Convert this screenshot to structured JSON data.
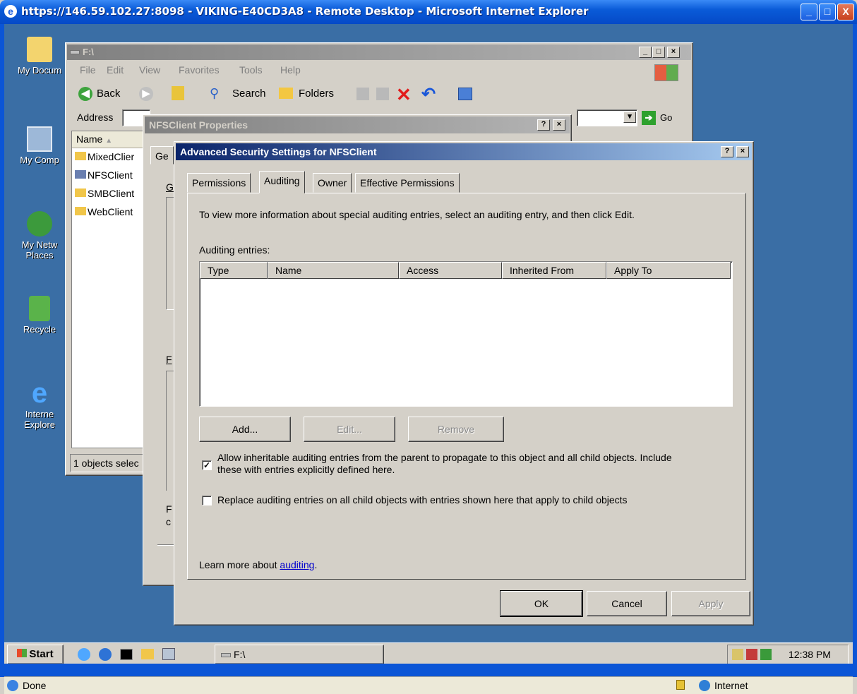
{
  "ie": {
    "title": "https://146.59.102.27:8098 - VIKING-E40CD3A8 - Remote Desktop - Microsoft Internet Explorer",
    "controls": {
      "minimize": "_",
      "maximize": "□",
      "close": "X"
    }
  },
  "desktop": {
    "icons": [
      {
        "label": "My Docum"
      },
      {
        "label": "My Comp"
      },
      {
        "label": "My Netw\nPlaces"
      },
      {
        "label": "Recycle"
      },
      {
        "label": "Interne\nExplore"
      }
    ]
  },
  "explorer": {
    "title": "F:\\",
    "menu": [
      "File",
      "Edit",
      "View",
      "Favorites",
      "Tools",
      "Help"
    ],
    "toolbar": {
      "back": "Back",
      "search": "Search",
      "folders": "Folders"
    },
    "address_label": "Address",
    "go_label": "Go",
    "column_name": "Name",
    "items": [
      "MixedClier",
      "NFSClient",
      "SMBClient",
      "WebClient"
    ],
    "status": "1 objects selec"
  },
  "properties": {
    "title": "NFSClient Properties",
    "tab_first": "Ge",
    "letters": [
      "G",
      "F",
      "F",
      "c"
    ]
  },
  "advanced": {
    "title": "Advanced Security Settings for NFSClient",
    "tabs": [
      "Permissions",
      "Auditing",
      "Owner",
      "Effective Permissions"
    ],
    "active_tab": "Auditing",
    "info_text": "To view more information about special auditing entries, select an auditing entry, and then click Edit.",
    "entries_label": "Auditing entries:",
    "columns": [
      "Type",
      "Name",
      "Access",
      "Inherited From",
      "Apply To"
    ],
    "buttons": {
      "add": "Add...",
      "edit": "Edit...",
      "remove": "Remove"
    },
    "check_inherit_line1": "Allow inheritable auditing entries from the parent to propagate to this object and all child objects. Include",
    "check_inherit_line2": "these with entries explicitly defined here.",
    "check_inherit_checked": true,
    "check_replace": "Replace auditing entries on all child objects with entries shown here that apply to child objects",
    "check_replace_checked": false,
    "learn_more_prefix": "Learn more about ",
    "learn_more_link": "auditing",
    "learn_more_suffix": ".",
    "ok": "OK",
    "cancel": "Cancel",
    "apply": "Apply"
  },
  "taskbar": {
    "start": "Start",
    "task_label": "F:\\",
    "clock": "12:38 PM"
  },
  "statusbar": {
    "status": "Done",
    "zone": "Internet"
  },
  "colors": {
    "desktop": "#3a6ea5",
    "active_title": "#0a246a",
    "xp_blue": "#0b55d6",
    "link": "#0000cc"
  }
}
